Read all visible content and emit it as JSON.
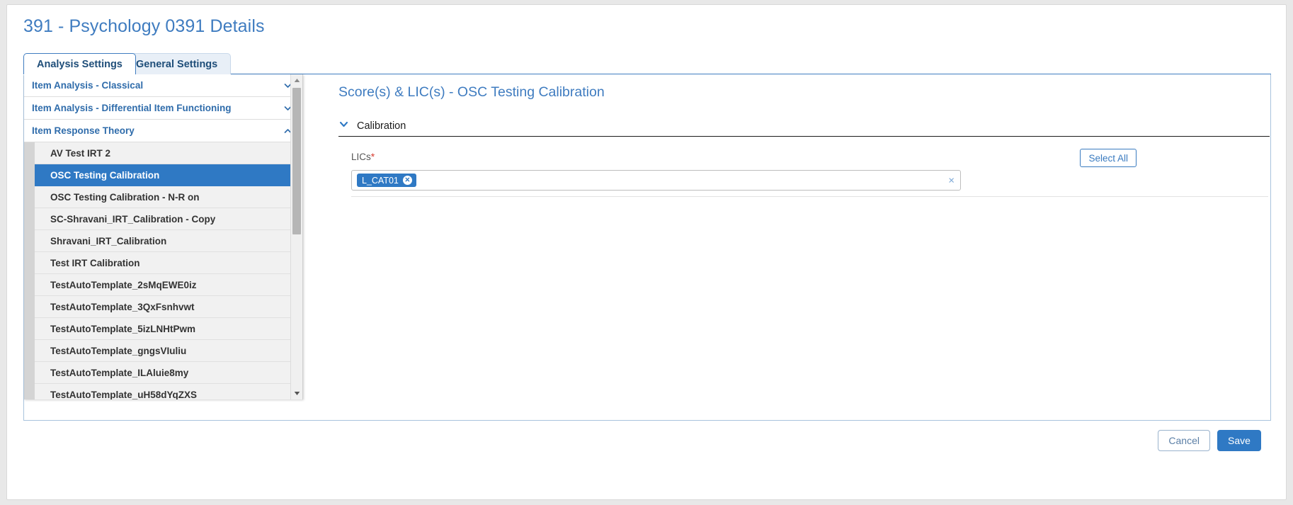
{
  "page": {
    "title": "391 - Psychology 0391 Details"
  },
  "tabs": [
    {
      "label": "Analysis Settings",
      "active": true
    },
    {
      "label": "General Settings",
      "active": false
    }
  ],
  "sidebar": {
    "sections": [
      {
        "label": "Item Analysis - Classical",
        "expanded": false,
        "icon": "chevron-down-icon"
      },
      {
        "label": "Item Analysis - Differential Item Functioning",
        "expanded": false,
        "icon": "chevron-down-icon"
      },
      {
        "label": "Item Response Theory",
        "expanded": true,
        "icon": "chevron-up-icon"
      }
    ],
    "items": [
      {
        "label": "AV Test IRT 2",
        "selected": false
      },
      {
        "label": "OSC Testing Calibration",
        "selected": true
      },
      {
        "label": "OSC Testing Calibration - N-R on",
        "selected": false
      },
      {
        "label": "SC-Shravani_IRT_Calibration - Copy",
        "selected": false
      },
      {
        "label": "Shravani_IRT_Calibration",
        "selected": false
      },
      {
        "label": "Test IRT Calibration",
        "selected": false
      },
      {
        "label": "TestAutoTemplate_2sMqEWE0iz",
        "selected": false
      },
      {
        "label": "TestAutoTemplate_3QxFsnhvwt",
        "selected": false
      },
      {
        "label": "TestAutoTemplate_5izLNHtPwm",
        "selected": false
      },
      {
        "label": "TestAutoTemplate_gngsVIuliu",
        "selected": false
      },
      {
        "label": "TestAutoTemplate_ILAluie8my",
        "selected": false
      },
      {
        "label": "TestAutoTemplate_uH58dYqZXS",
        "selected": false
      }
    ],
    "scrollbar": {
      "up_icon": "scroll-up-arrow-icon",
      "down_icon": "scroll-down-arrow-icon"
    }
  },
  "content": {
    "title": "Score(s) & LIC(s) - OSC Testing Calibration",
    "section": {
      "label": "Calibration",
      "expanded": true,
      "icon": "chevron-down-icon"
    },
    "lics_field": {
      "label": "LICs",
      "required_marker": "*",
      "select_all_label": "Select All",
      "chips": [
        {
          "label": "L_CAT01",
          "remove_icon": "chip-remove-icon",
          "remove_glyph": "✕"
        }
      ],
      "clear_glyph": "×",
      "clear_icon": "clear-selection-icon"
    }
  },
  "footer": {
    "cancel_label": "Cancel",
    "save_label": "Save"
  },
  "colors": {
    "accent": "#2f79c4",
    "title": "#3f7cc0",
    "required": "#d63b2f",
    "selected_row": "#2f79c4"
  }
}
